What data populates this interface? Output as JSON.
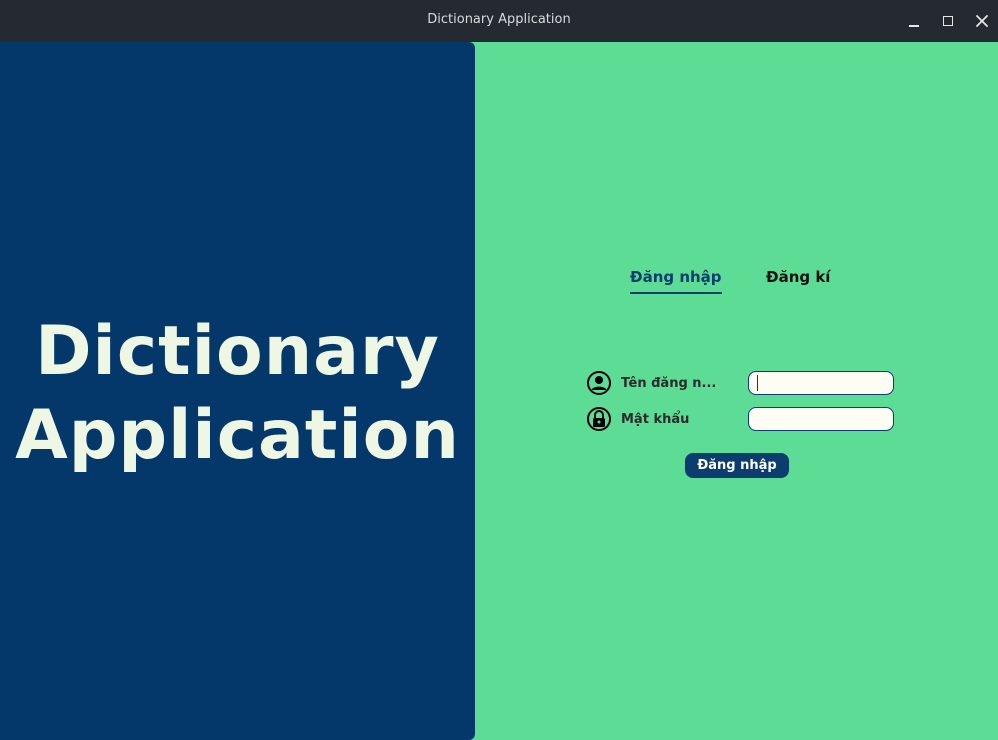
{
  "window": {
    "title": "Dictionary Application",
    "controls": [
      "minimize-icon",
      "maximize-icon",
      "close-icon"
    ]
  },
  "brand": {
    "line1": "Dictionary",
    "line2": "Application"
  },
  "tabs": [
    {
      "label": "Đăng nhập",
      "active": true
    },
    {
      "label": "Đăng kí",
      "active": false
    }
  ],
  "form": {
    "username": {
      "label": "Tên đăng n...",
      "icon": "user-icon",
      "value": ""
    },
    "password": {
      "label": "Mật khẩu",
      "icon": "lock-icon",
      "value": ""
    },
    "submit_label": "Đăng nhập"
  },
  "colors": {
    "left_panel": "#04376a",
    "right_panel": "#5cdc94",
    "accent": "#0b3d6e",
    "titlebar": "#252a31"
  }
}
